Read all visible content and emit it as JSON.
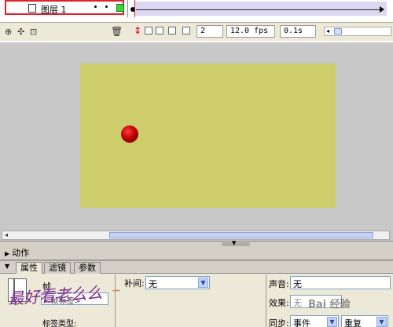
{
  "timeline": {
    "layer_name": "图层 1",
    "counter_frame": "2",
    "counter_fps": "12.0 fps",
    "counter_time": "0.1s"
  },
  "panels": {
    "actions_label": "动作",
    "tabs": [
      "属性",
      "滤镜",
      "参数"
    ]
  },
  "properties": {
    "frame_label": "帧",
    "frame_name_placeholder": "<帧标签>",
    "label_type_label": "标签类型:",
    "tween_label": "补间:",
    "tween_value": "无",
    "sound_label": "声音:",
    "sound_value": "无",
    "effect_label": "效果:",
    "effect_value": "无",
    "sync_label": "同步:",
    "sync_value": "事件",
    "repeat_value": "重复"
  },
  "watermarks": {
    "left": "最好看老么么",
    "right": "Bai 经验"
  },
  "colors": {
    "stage": "#cdcd6b",
    "highlight": "#e0202a",
    "ball": "#c00000"
  }
}
